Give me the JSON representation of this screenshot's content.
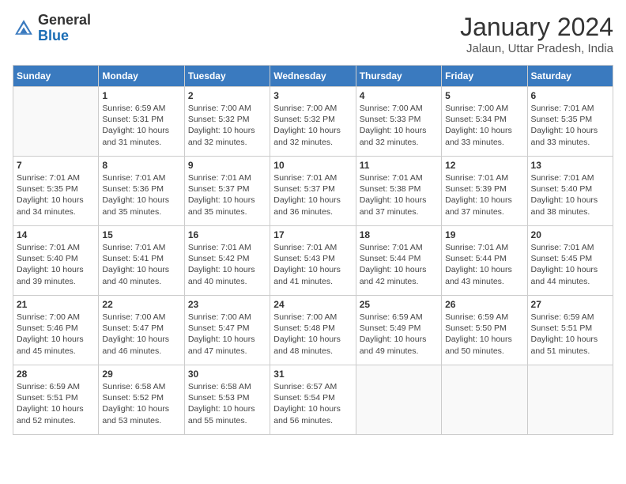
{
  "header": {
    "logo_general": "General",
    "logo_blue": "Blue",
    "month_title": "January 2024",
    "location": "Jalaun, Uttar Pradesh, India"
  },
  "days_of_week": [
    "Sunday",
    "Monday",
    "Tuesday",
    "Wednesday",
    "Thursday",
    "Friday",
    "Saturday"
  ],
  "weeks": [
    [
      {
        "day": "",
        "info": ""
      },
      {
        "day": "1",
        "info": "Sunrise: 6:59 AM\nSunset: 5:31 PM\nDaylight: 10 hours\nand 31 minutes."
      },
      {
        "day": "2",
        "info": "Sunrise: 7:00 AM\nSunset: 5:32 PM\nDaylight: 10 hours\nand 32 minutes."
      },
      {
        "day": "3",
        "info": "Sunrise: 7:00 AM\nSunset: 5:32 PM\nDaylight: 10 hours\nand 32 minutes."
      },
      {
        "day": "4",
        "info": "Sunrise: 7:00 AM\nSunset: 5:33 PM\nDaylight: 10 hours\nand 32 minutes."
      },
      {
        "day": "5",
        "info": "Sunrise: 7:00 AM\nSunset: 5:34 PM\nDaylight: 10 hours\nand 33 minutes."
      },
      {
        "day": "6",
        "info": "Sunrise: 7:01 AM\nSunset: 5:35 PM\nDaylight: 10 hours\nand 33 minutes."
      }
    ],
    [
      {
        "day": "7",
        "info": "Sunrise: 7:01 AM\nSunset: 5:35 PM\nDaylight: 10 hours\nand 34 minutes."
      },
      {
        "day": "8",
        "info": "Sunrise: 7:01 AM\nSunset: 5:36 PM\nDaylight: 10 hours\nand 35 minutes."
      },
      {
        "day": "9",
        "info": "Sunrise: 7:01 AM\nSunset: 5:37 PM\nDaylight: 10 hours\nand 35 minutes."
      },
      {
        "day": "10",
        "info": "Sunrise: 7:01 AM\nSunset: 5:37 PM\nDaylight: 10 hours\nand 36 minutes."
      },
      {
        "day": "11",
        "info": "Sunrise: 7:01 AM\nSunset: 5:38 PM\nDaylight: 10 hours\nand 37 minutes."
      },
      {
        "day": "12",
        "info": "Sunrise: 7:01 AM\nSunset: 5:39 PM\nDaylight: 10 hours\nand 37 minutes."
      },
      {
        "day": "13",
        "info": "Sunrise: 7:01 AM\nSunset: 5:40 PM\nDaylight: 10 hours\nand 38 minutes."
      }
    ],
    [
      {
        "day": "14",
        "info": "Sunrise: 7:01 AM\nSunset: 5:40 PM\nDaylight: 10 hours\nand 39 minutes."
      },
      {
        "day": "15",
        "info": "Sunrise: 7:01 AM\nSunset: 5:41 PM\nDaylight: 10 hours\nand 40 minutes."
      },
      {
        "day": "16",
        "info": "Sunrise: 7:01 AM\nSunset: 5:42 PM\nDaylight: 10 hours\nand 40 minutes."
      },
      {
        "day": "17",
        "info": "Sunrise: 7:01 AM\nSunset: 5:43 PM\nDaylight: 10 hours\nand 41 minutes."
      },
      {
        "day": "18",
        "info": "Sunrise: 7:01 AM\nSunset: 5:44 PM\nDaylight: 10 hours\nand 42 minutes."
      },
      {
        "day": "19",
        "info": "Sunrise: 7:01 AM\nSunset: 5:44 PM\nDaylight: 10 hours\nand 43 minutes."
      },
      {
        "day": "20",
        "info": "Sunrise: 7:01 AM\nSunset: 5:45 PM\nDaylight: 10 hours\nand 44 minutes."
      }
    ],
    [
      {
        "day": "21",
        "info": "Sunrise: 7:00 AM\nSunset: 5:46 PM\nDaylight: 10 hours\nand 45 minutes."
      },
      {
        "day": "22",
        "info": "Sunrise: 7:00 AM\nSunset: 5:47 PM\nDaylight: 10 hours\nand 46 minutes."
      },
      {
        "day": "23",
        "info": "Sunrise: 7:00 AM\nSunset: 5:47 PM\nDaylight: 10 hours\nand 47 minutes."
      },
      {
        "day": "24",
        "info": "Sunrise: 7:00 AM\nSunset: 5:48 PM\nDaylight: 10 hours\nand 48 minutes."
      },
      {
        "day": "25",
        "info": "Sunrise: 6:59 AM\nSunset: 5:49 PM\nDaylight: 10 hours\nand 49 minutes."
      },
      {
        "day": "26",
        "info": "Sunrise: 6:59 AM\nSunset: 5:50 PM\nDaylight: 10 hours\nand 50 minutes."
      },
      {
        "day": "27",
        "info": "Sunrise: 6:59 AM\nSunset: 5:51 PM\nDaylight: 10 hours\nand 51 minutes."
      }
    ],
    [
      {
        "day": "28",
        "info": "Sunrise: 6:59 AM\nSunset: 5:51 PM\nDaylight: 10 hours\nand 52 minutes."
      },
      {
        "day": "29",
        "info": "Sunrise: 6:58 AM\nSunset: 5:52 PM\nDaylight: 10 hours\nand 53 minutes."
      },
      {
        "day": "30",
        "info": "Sunrise: 6:58 AM\nSunset: 5:53 PM\nDaylight: 10 hours\nand 55 minutes."
      },
      {
        "day": "31",
        "info": "Sunrise: 6:57 AM\nSunset: 5:54 PM\nDaylight: 10 hours\nand 56 minutes."
      },
      {
        "day": "",
        "info": ""
      },
      {
        "day": "",
        "info": ""
      },
      {
        "day": "",
        "info": ""
      }
    ]
  ]
}
